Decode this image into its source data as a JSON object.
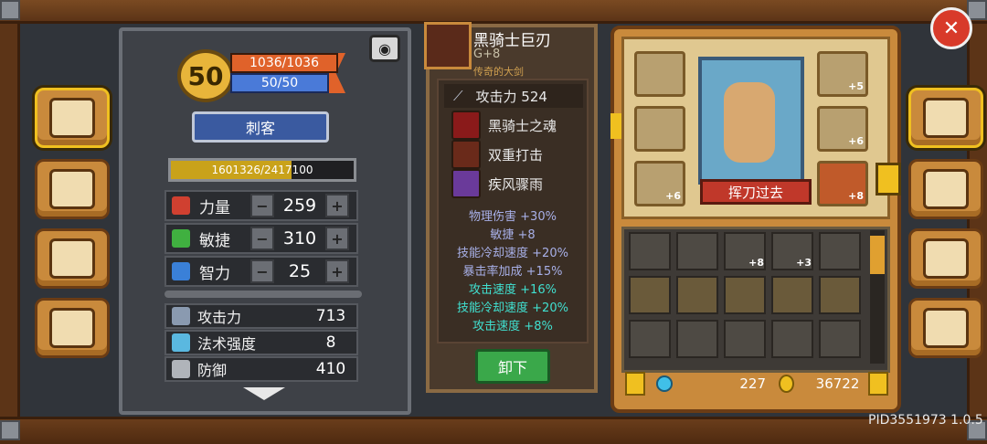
{
  "level": "50",
  "hp": "1036/1036",
  "mp": "50/50",
  "character_class": "刺客",
  "experience": {
    "text": "1601326/2417100",
    "fraction": 0.662
  },
  "attributes": [
    {
      "label": "力量",
      "value": "259",
      "color": "#d04030",
      "icon": "fist-icon"
    },
    {
      "label": "敏捷",
      "value": "310",
      "color": "#40b040",
      "icon": "feather-icon"
    },
    {
      "label": "智力",
      "value": "25",
      "color": "#3a80d8",
      "icon": "book-icon"
    }
  ],
  "stats": [
    {
      "label": "攻击力",
      "value": "713",
      "icon": "sword-icon"
    },
    {
      "label": "法术强度",
      "value": "8",
      "icon": "wand-icon"
    },
    {
      "label": "防御",
      "value": "410",
      "icon": "shield-icon"
    }
  ],
  "weapon": {
    "name": "黑骑士巨刃",
    "upgrade": "G+8",
    "type": "传奇的大剑",
    "attack": "攻击力 524",
    "skills": [
      {
        "label": "黑骑士之魂",
        "icon": "dark-flame-icon",
        "color": "#8a1a1a"
      },
      {
        "label": "双重打击",
        "icon": "slash-icon",
        "color": "#6a2a1a"
      },
      {
        "label": "疾风骤雨",
        "icon": "tornado-icon",
        "color": "#6a3a9a"
      }
    ],
    "bonuses": [
      {
        "text": "物理伤害 +30%",
        "color": "#a8b0e8"
      },
      {
        "text": "敏捷 +8",
        "color": "#a8b0e8"
      },
      {
        "text": "技能冷却速度 +20%",
        "color": "#a8b0e8"
      },
      {
        "text": "暴击率加成 +15%",
        "color": "#a8b0e8"
      },
      {
        "text": "攻击速度 +16%",
        "color": "#40e0d0"
      },
      {
        "text": "技能冷却速度 +20%",
        "color": "#40e0d0"
      },
      {
        "text": "攻击速度 +8%",
        "color": "#40e0d0"
      }
    ],
    "unequip_label": "卸下"
  },
  "equipment": {
    "left_slots": [
      "",
      "",
      "+6"
    ],
    "right_slots": [
      "+5",
      "+6",
      "+8"
    ],
    "skill_name": "挥刀过去"
  },
  "inventory": {
    "row1_badges": [
      "",
      "",
      "+8",
      "+3",
      ""
    ],
    "gems": "227",
    "coins": "36722"
  },
  "pid": "PID3551973 1.0.5"
}
